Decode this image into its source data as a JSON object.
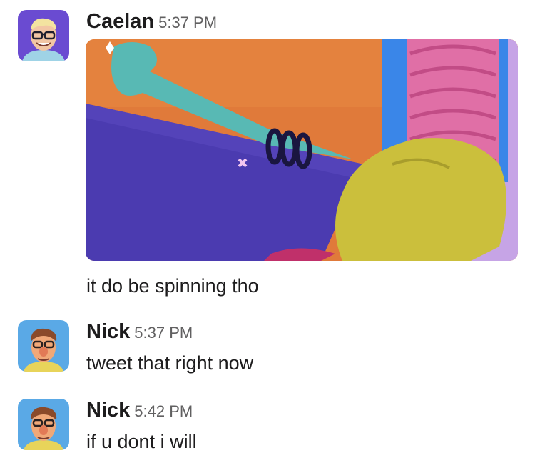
{
  "messages": [
    {
      "author": "Caelan",
      "time": "5:37 PM",
      "attachment_icon": "gif-image",
      "text": "it do be spinning tho",
      "avatar_color": "#6a4bd1"
    },
    {
      "author": "Nick",
      "time": "5:37 PM",
      "text": "tweet that right now",
      "avatar_color": "#5aa9e6"
    },
    {
      "author": "Nick",
      "time": "5:42 PM",
      "text": "if u dont i will",
      "avatar_color": "#5aa9e6"
    }
  ],
  "colors": {
    "name": "#1d1c1d",
    "timestamp": "#616061",
    "text": "#1d1c1d"
  }
}
